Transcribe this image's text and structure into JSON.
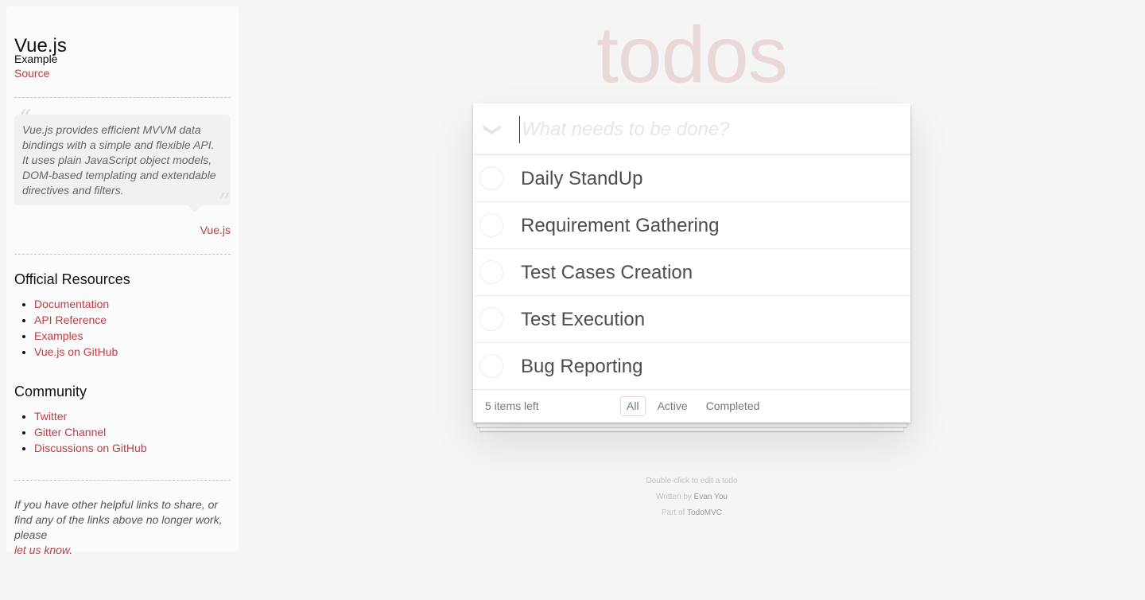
{
  "sidebar": {
    "title": "Vue.js",
    "example_label": "Example",
    "source_link": "Source",
    "quote_open_mark": "“",
    "quote_close_mark": "”",
    "quote": "Vue.js provides efficient MVVM data bindings with a simple and flexible API. It uses plain JavaScript object models, DOM-based templating and extendable directives and filters.",
    "quote_source": "Vue.js",
    "resources_heading": "Official Resources",
    "resources": [
      "Documentation",
      "API Reference",
      "Examples",
      "Vue.js on GitHub"
    ],
    "community_heading": "Community",
    "community": [
      "Twitter",
      "Gitter Channel",
      "Discussions on GitHub"
    ],
    "footnote_text": "If you have other helpful links to share, or find any of the links above no longer work, please",
    "footnote_link": "let us know",
    "footnote_end": "."
  },
  "app": {
    "title": "todos",
    "toggle_all_icon": "chevron-down-icon",
    "toggle_all_glyph": "❯",
    "new_todo_placeholder": "What needs to be done?",
    "new_todo_value": "",
    "todos": [
      {
        "label": "Daily StandUp",
        "completed": false
      },
      {
        "label": "Requirement Gathering",
        "completed": false
      },
      {
        "label": "Test Cases Creation",
        "completed": false
      },
      {
        "label": "Test Execution",
        "completed": false
      },
      {
        "label": "Bug Reporting",
        "completed": false
      }
    ],
    "count_text": "5 items left",
    "filters": [
      "All",
      "Active",
      "Completed"
    ],
    "selected_filter": "All"
  },
  "info": {
    "hint": "Double-click to edit a todo",
    "written_by_prefix": "Written by",
    "author": "Evan You",
    "part_of_prefix": "Part of",
    "project": "TodoMVC"
  },
  "colors": {
    "accent": "#b83f45",
    "title_color": "rgba(175,47,47,0.15)",
    "background": "#f5f5f5"
  }
}
